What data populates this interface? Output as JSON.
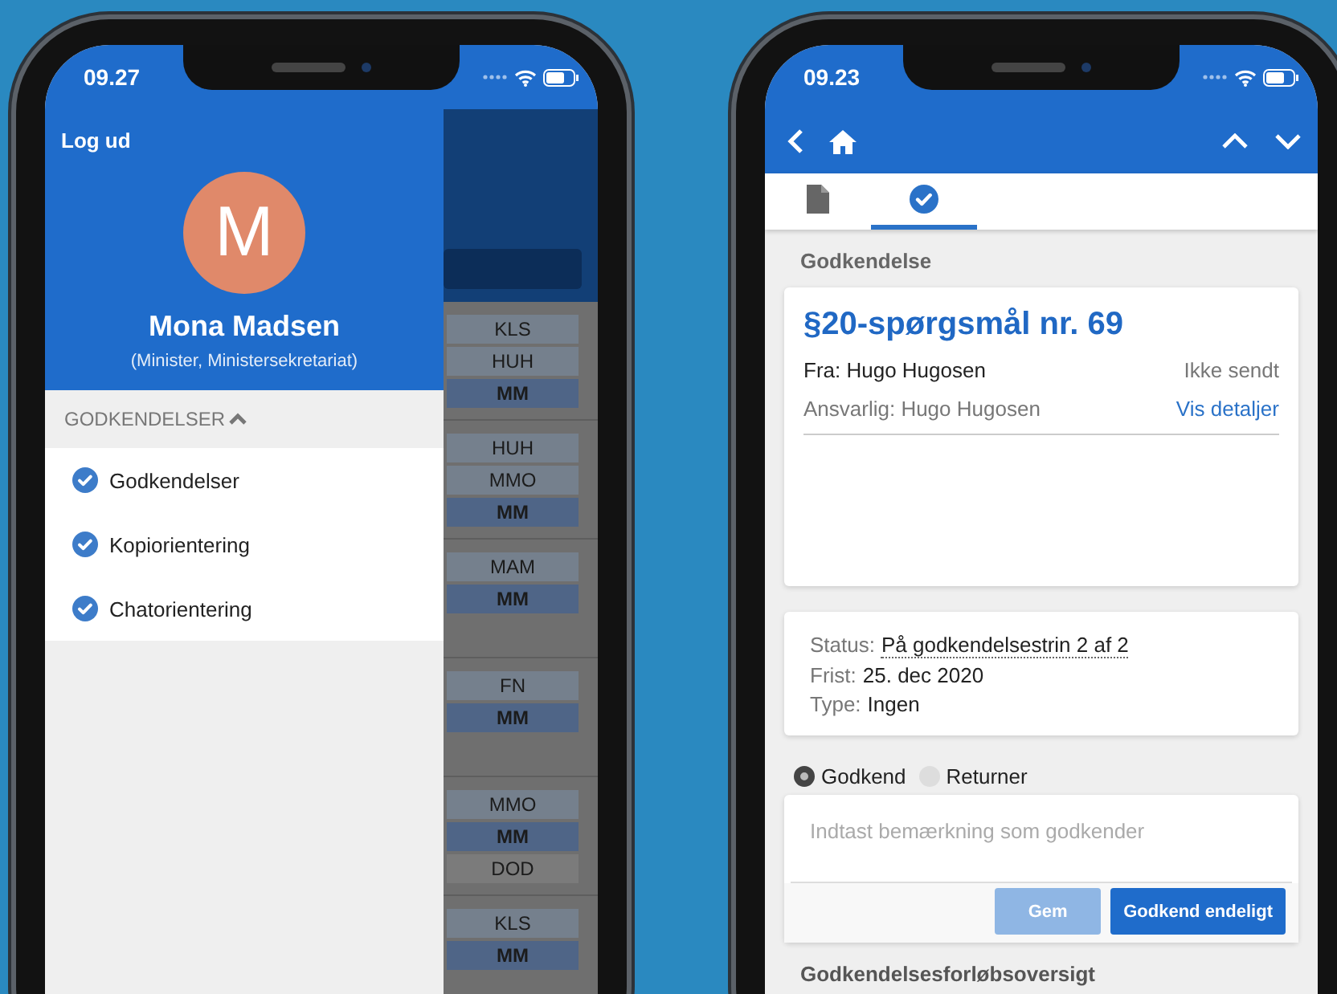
{
  "left_phone": {
    "status_bar": {
      "time": "09.27"
    },
    "drawer": {
      "logout": "Log ud",
      "avatar_initial": "M",
      "name": "Mona Madsen",
      "role": "(Minister, Ministersekretariat)",
      "section": {
        "title": "GODKENDELSER",
        "expanded": true,
        "items": [
          {
            "label": "Godkendelser",
            "checked": true
          },
          {
            "label": "Kopiorientering",
            "checked": true
          },
          {
            "label": "Chatorientering",
            "checked": true
          }
        ]
      }
    },
    "background_list": {
      "groups": [
        {
          "tags": [
            {
              "label": "KLS",
              "kind": "other"
            },
            {
              "label": "HUH",
              "kind": "other"
            },
            {
              "label": "MM",
              "kind": "self"
            }
          ]
        },
        {
          "tags": [
            {
              "label": "HUH",
              "kind": "other"
            },
            {
              "label": "MMO",
              "kind": "other"
            },
            {
              "label": "MM",
              "kind": "self"
            }
          ]
        },
        {
          "tags": [
            {
              "label": "MAM",
              "kind": "other"
            },
            {
              "label": "MM",
              "kind": "self"
            }
          ]
        },
        {
          "tags": [
            {
              "label": "FN",
              "kind": "other"
            },
            {
              "label": "MM",
              "kind": "self"
            }
          ]
        },
        {
          "tags": [
            {
              "label": "MMO",
              "kind": "other"
            },
            {
              "label": "MM",
              "kind": "self"
            },
            {
              "label": "DOD",
              "kind": "inactive"
            }
          ]
        },
        {
          "tags": [
            {
              "label": "KLS",
              "kind": "other"
            },
            {
              "label": "MM",
              "kind": "self"
            }
          ]
        }
      ]
    }
  },
  "right_phone": {
    "status_bar": {
      "time": "09.23"
    },
    "tabs": [
      {
        "kind": "document",
        "selected": false
      },
      {
        "kind": "check",
        "selected": true
      }
    ],
    "section_title": "Godkendelse",
    "case": {
      "title": "§20-spørgsmål nr. 69",
      "from": "Fra: Hugo Hugosen",
      "send_status": "Ikke sendt",
      "responsible": "Ansvarlig: Hugo Hugosen",
      "details_link": "Vis detaljer"
    },
    "info": [
      {
        "label": "Status:",
        "value": "På godkendelsestrin 2 af 2",
        "kind": "dotted"
      },
      {
        "label": "Frist:",
        "value": "25. dec 2020",
        "kind": "plain"
      },
      {
        "label": "Type:",
        "value": "Ingen",
        "kind": "plain"
      }
    ],
    "decision": [
      {
        "label": "Godkend",
        "selected": true
      },
      {
        "label": "Returner",
        "selected": false
      }
    ],
    "remark": {
      "placeholder": "Indtast bemærkning som godkender"
    },
    "buttons": [
      {
        "label": "Gem",
        "disabled": true
      },
      {
        "label": "Godkend endeligt",
        "disabled": false
      }
    ],
    "next_section": "Godkendelsesforløbsoversigt"
  }
}
